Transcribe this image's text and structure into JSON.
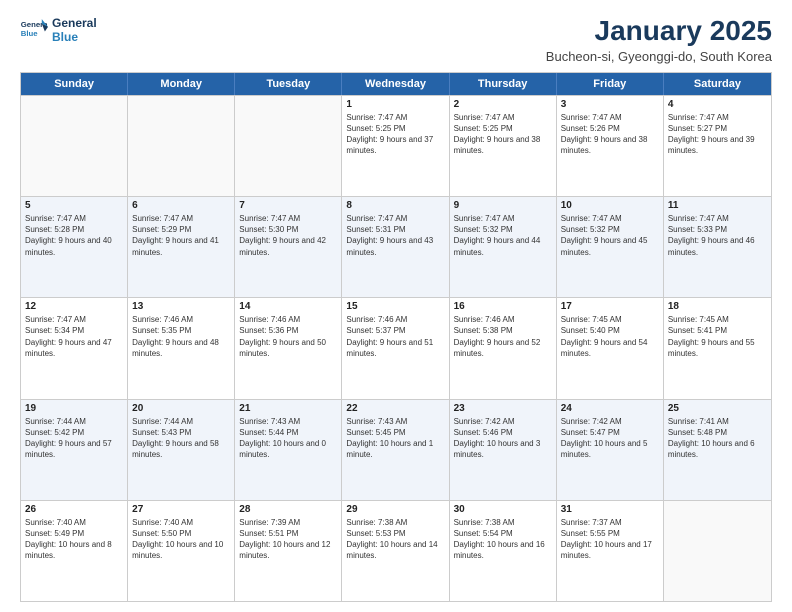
{
  "logo": {
    "line1": "General",
    "line2": "Blue"
  },
  "title": "January 2025",
  "subtitle": "Bucheon-si, Gyeonggi-do, South Korea",
  "headers": [
    "Sunday",
    "Monday",
    "Tuesday",
    "Wednesday",
    "Thursday",
    "Friday",
    "Saturday"
  ],
  "weeks": [
    [
      {
        "day": "",
        "sunrise": "",
        "sunset": "",
        "daylight": ""
      },
      {
        "day": "",
        "sunrise": "",
        "sunset": "",
        "daylight": ""
      },
      {
        "day": "",
        "sunrise": "",
        "sunset": "",
        "daylight": ""
      },
      {
        "day": "1",
        "sunrise": "Sunrise: 7:47 AM",
        "sunset": "Sunset: 5:25 PM",
        "daylight": "Daylight: 9 hours and 37 minutes."
      },
      {
        "day": "2",
        "sunrise": "Sunrise: 7:47 AM",
        "sunset": "Sunset: 5:25 PM",
        "daylight": "Daylight: 9 hours and 38 minutes."
      },
      {
        "day": "3",
        "sunrise": "Sunrise: 7:47 AM",
        "sunset": "Sunset: 5:26 PM",
        "daylight": "Daylight: 9 hours and 38 minutes."
      },
      {
        "day": "4",
        "sunrise": "Sunrise: 7:47 AM",
        "sunset": "Sunset: 5:27 PM",
        "daylight": "Daylight: 9 hours and 39 minutes."
      }
    ],
    [
      {
        "day": "5",
        "sunrise": "Sunrise: 7:47 AM",
        "sunset": "Sunset: 5:28 PM",
        "daylight": "Daylight: 9 hours and 40 minutes."
      },
      {
        "day": "6",
        "sunrise": "Sunrise: 7:47 AM",
        "sunset": "Sunset: 5:29 PM",
        "daylight": "Daylight: 9 hours and 41 minutes."
      },
      {
        "day": "7",
        "sunrise": "Sunrise: 7:47 AM",
        "sunset": "Sunset: 5:30 PM",
        "daylight": "Daylight: 9 hours and 42 minutes."
      },
      {
        "day": "8",
        "sunrise": "Sunrise: 7:47 AM",
        "sunset": "Sunset: 5:31 PM",
        "daylight": "Daylight: 9 hours and 43 minutes."
      },
      {
        "day": "9",
        "sunrise": "Sunrise: 7:47 AM",
        "sunset": "Sunset: 5:32 PM",
        "daylight": "Daylight: 9 hours and 44 minutes."
      },
      {
        "day": "10",
        "sunrise": "Sunrise: 7:47 AM",
        "sunset": "Sunset: 5:32 PM",
        "daylight": "Daylight: 9 hours and 45 minutes."
      },
      {
        "day": "11",
        "sunrise": "Sunrise: 7:47 AM",
        "sunset": "Sunset: 5:33 PM",
        "daylight": "Daylight: 9 hours and 46 minutes."
      }
    ],
    [
      {
        "day": "12",
        "sunrise": "Sunrise: 7:47 AM",
        "sunset": "Sunset: 5:34 PM",
        "daylight": "Daylight: 9 hours and 47 minutes."
      },
      {
        "day": "13",
        "sunrise": "Sunrise: 7:46 AM",
        "sunset": "Sunset: 5:35 PM",
        "daylight": "Daylight: 9 hours and 48 minutes."
      },
      {
        "day": "14",
        "sunrise": "Sunrise: 7:46 AM",
        "sunset": "Sunset: 5:36 PM",
        "daylight": "Daylight: 9 hours and 50 minutes."
      },
      {
        "day": "15",
        "sunrise": "Sunrise: 7:46 AM",
        "sunset": "Sunset: 5:37 PM",
        "daylight": "Daylight: 9 hours and 51 minutes."
      },
      {
        "day": "16",
        "sunrise": "Sunrise: 7:46 AM",
        "sunset": "Sunset: 5:38 PM",
        "daylight": "Daylight: 9 hours and 52 minutes."
      },
      {
        "day": "17",
        "sunrise": "Sunrise: 7:45 AM",
        "sunset": "Sunset: 5:40 PM",
        "daylight": "Daylight: 9 hours and 54 minutes."
      },
      {
        "day": "18",
        "sunrise": "Sunrise: 7:45 AM",
        "sunset": "Sunset: 5:41 PM",
        "daylight": "Daylight: 9 hours and 55 minutes."
      }
    ],
    [
      {
        "day": "19",
        "sunrise": "Sunrise: 7:44 AM",
        "sunset": "Sunset: 5:42 PM",
        "daylight": "Daylight: 9 hours and 57 minutes."
      },
      {
        "day": "20",
        "sunrise": "Sunrise: 7:44 AM",
        "sunset": "Sunset: 5:43 PM",
        "daylight": "Daylight: 9 hours and 58 minutes."
      },
      {
        "day": "21",
        "sunrise": "Sunrise: 7:43 AM",
        "sunset": "Sunset: 5:44 PM",
        "daylight": "Daylight: 10 hours and 0 minutes."
      },
      {
        "day": "22",
        "sunrise": "Sunrise: 7:43 AM",
        "sunset": "Sunset: 5:45 PM",
        "daylight": "Daylight: 10 hours and 1 minute."
      },
      {
        "day": "23",
        "sunrise": "Sunrise: 7:42 AM",
        "sunset": "Sunset: 5:46 PM",
        "daylight": "Daylight: 10 hours and 3 minutes."
      },
      {
        "day": "24",
        "sunrise": "Sunrise: 7:42 AM",
        "sunset": "Sunset: 5:47 PM",
        "daylight": "Daylight: 10 hours and 5 minutes."
      },
      {
        "day": "25",
        "sunrise": "Sunrise: 7:41 AM",
        "sunset": "Sunset: 5:48 PM",
        "daylight": "Daylight: 10 hours and 6 minutes."
      }
    ],
    [
      {
        "day": "26",
        "sunrise": "Sunrise: 7:40 AM",
        "sunset": "Sunset: 5:49 PM",
        "daylight": "Daylight: 10 hours and 8 minutes."
      },
      {
        "day": "27",
        "sunrise": "Sunrise: 7:40 AM",
        "sunset": "Sunset: 5:50 PM",
        "daylight": "Daylight: 10 hours and 10 minutes."
      },
      {
        "day": "28",
        "sunrise": "Sunrise: 7:39 AM",
        "sunset": "Sunset: 5:51 PM",
        "daylight": "Daylight: 10 hours and 12 minutes."
      },
      {
        "day": "29",
        "sunrise": "Sunrise: 7:38 AM",
        "sunset": "Sunset: 5:53 PM",
        "daylight": "Daylight: 10 hours and 14 minutes."
      },
      {
        "day": "30",
        "sunrise": "Sunrise: 7:38 AM",
        "sunset": "Sunset: 5:54 PM",
        "daylight": "Daylight: 10 hours and 16 minutes."
      },
      {
        "day": "31",
        "sunrise": "Sunrise: 7:37 AM",
        "sunset": "Sunset: 5:55 PM",
        "daylight": "Daylight: 10 hours and 17 minutes."
      },
      {
        "day": "",
        "sunrise": "",
        "sunset": "",
        "daylight": ""
      }
    ]
  ]
}
